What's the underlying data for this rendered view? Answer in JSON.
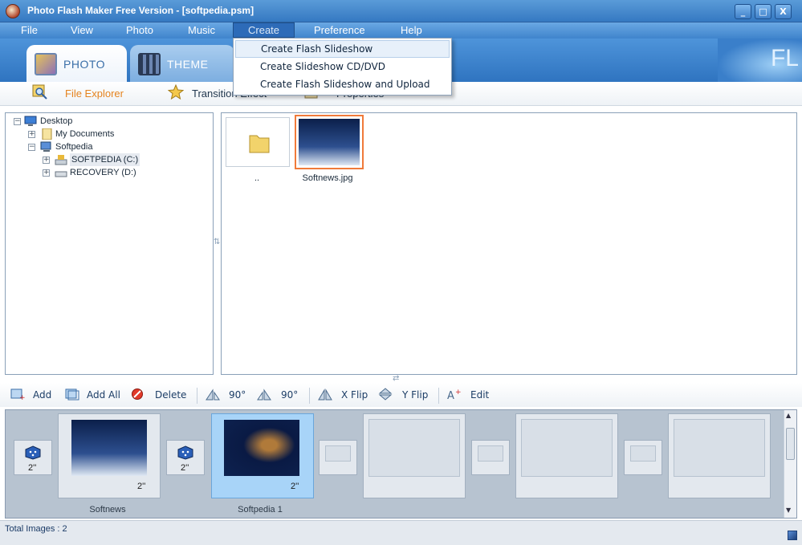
{
  "window": {
    "title": "Photo Flash Maker Free Version - [softpedia.psm]",
    "minimize": "_",
    "maximize": "□",
    "close": "X"
  },
  "menu": {
    "items": [
      "File",
      "View",
      "Photo",
      "Music",
      "Create",
      "Preference",
      "Help"
    ]
  },
  "create_menu": {
    "items": [
      "Create Flash Slideshow",
      "Create Slideshow CD/DVD",
      "Create Flash Slideshow and Upload"
    ]
  },
  "tabs": {
    "photo": "PHOTO",
    "theme": "THEME"
  },
  "banner_text": "FL",
  "subtabs": {
    "file_explorer": "File Explorer",
    "transition": "Transition Effect",
    "properties": "Properties"
  },
  "tree": {
    "desktop": "Desktop",
    "my_documents": "My Documents",
    "softpedia": "Softpedia",
    "drive_c": "SOFTPEDIA (C:)",
    "drive_d": "RECOVERY (D:)"
  },
  "files": {
    "parent": "..",
    "image": "Softnews.jpg"
  },
  "actions": {
    "add": "Add",
    "add_all": "Add All",
    "delete": "Delete",
    "rot_left": "90°",
    "rot_right": "90°",
    "x_flip": "X Flip",
    "y_flip": "Y Flip",
    "edit": "Edit"
  },
  "storyboard": {
    "transition_duration": "2''",
    "slides": [
      {
        "caption": "Softnews",
        "duration": "2''"
      },
      {
        "caption": "Softpedia 1",
        "duration": "2''"
      }
    ]
  },
  "status": {
    "total": "Total Images : 2"
  }
}
